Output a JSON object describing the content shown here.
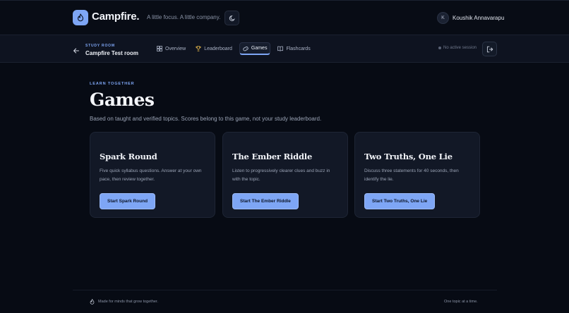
{
  "header": {
    "brand": "Campfire.",
    "tagline": "A little focus. A little company.",
    "user": {
      "initial": "K",
      "name": "Koushik Annavarapu"
    }
  },
  "room": {
    "eyebrow": "STUDY ROOM",
    "name": "Campfire Test room",
    "tabs": [
      {
        "label": "Overview",
        "icon": "grid-icon",
        "active": false
      },
      {
        "label": "Leaderboard",
        "icon": "trophy-icon",
        "active": false
      },
      {
        "label": "Games",
        "icon": "gamepad-icon",
        "active": true
      },
      {
        "label": "Flashcards",
        "icon": "book-icon",
        "active": false
      }
    ],
    "session_status": "No active session"
  },
  "main": {
    "eyebrow": "LEARN TOGETHER",
    "title": "Games",
    "description": "Based on taught and verified topics. Scores belong to this game, not your study leaderboard.",
    "games": [
      {
        "title": "Spark Round",
        "description": "Five quick syllabus questions. Answer at your own pace, then review together.",
        "button": "Start Spark Round"
      },
      {
        "title": "The Ember Riddle",
        "description": "Listen to progressively clearer clues and buzz in with the topic.",
        "button": "Start The Ember Riddle"
      },
      {
        "title": "Two Truths, One Lie",
        "description": "Discuss three statements for 40 seconds, then identify the lie.",
        "button": "Start Two Truths, One Lie"
      }
    ]
  },
  "footer": {
    "left": "Made for minds that grow together.",
    "right": "One topic at a time."
  },
  "colors": {
    "background": "#070b14",
    "accent": "#7ea6f5",
    "card": "#121826"
  }
}
